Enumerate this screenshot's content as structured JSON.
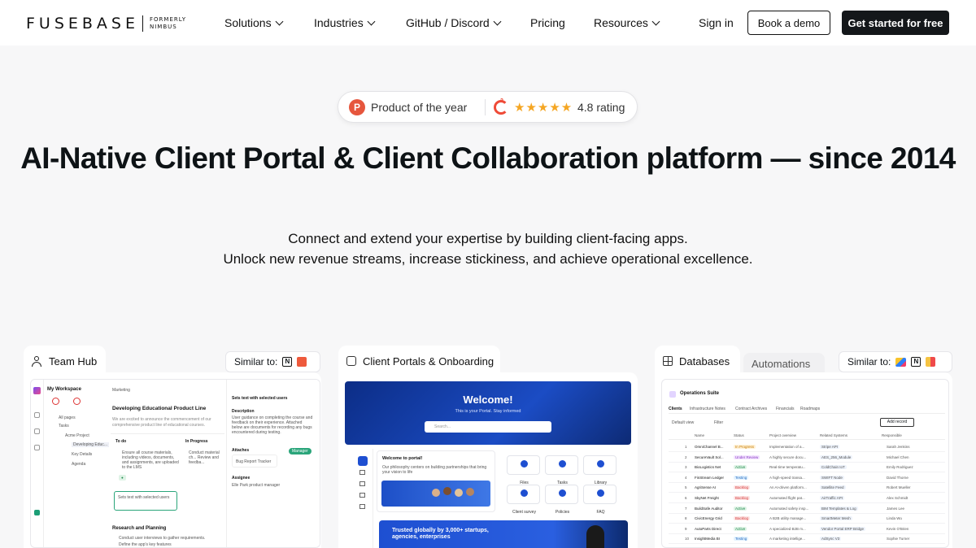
{
  "nav": {
    "logo_main": "FUSEBASE",
    "logo_sub": "FORMERLY NIMBUS",
    "items": [
      {
        "label": "Solutions",
        "has_menu": true
      },
      {
        "label": "Industries",
        "has_menu": true
      },
      {
        "label": "GitHub / Discord",
        "has_menu": true
      },
      {
        "label": "Pricing",
        "has_menu": false
      },
      {
        "label": "Resources",
        "has_menu": true
      }
    ],
    "sign_in": "Sign in",
    "book_demo": "Book a demo",
    "get_started": "Get started for free"
  },
  "badge": {
    "product_of_year": "Product of the year",
    "rating": "4.8 rating",
    "rating_value": 4.8,
    "ph_letter": "P",
    "stars": "★★★★★"
  },
  "hero": {
    "title": "AI-Native Client Portal & Client Collaboration platform — since 2014",
    "sub_line1": "Connect and extend your expertise by building client-facing apps.",
    "sub_line2": "Unlock new revenue streams, increase stickiness, and achieve operational excellence."
  },
  "cards": {
    "team_hub": {
      "tab": "Team Hub",
      "similar": "Similar to:",
      "workspace": "My Workspace",
      "marketing": "Marketing",
      "doc_title": "Developing Educational Product Line",
      "doc_text": "We are excited to announce the commencement of our comprehensive product line of educational courses.",
      "sidebar": [
        "All pages",
        "Tasks",
        "Acme Project",
        "Developing Educ...",
        "Key Details",
        "Agenda"
      ],
      "col_todo": "To do",
      "col_progress": "In Progress",
      "task1": "Ensure all course materials, including videos, documents, and assignments, are uploaded to the LMS",
      "task2": "Conduct material ch... Review and feedba...",
      "task3": "Sets text with selected users",
      "section": "Research and Planning",
      "check1": "Conduct user interviews to gather requirements.",
      "check2": "Define the app's key features",
      "side_title": "Sets text with selected users",
      "side_desc_label": "Description",
      "side_desc": "User guidance on completing the course and feedback on their experience. Attached below are documents for recording any bugs encountered during testing.",
      "attaches": "Attaches",
      "file": "Bug Report Tracker",
      "manager": "Manager",
      "assignee": "Assignee",
      "assignee_val": "Elle Park product manager"
    },
    "portals": {
      "tab": "Client Portals & Onboarding",
      "welcome": "Welcome!",
      "welcome_sub": "This is your Portal. Stay informed",
      "search_placeholder": "Search...",
      "welcome_portal": "Welcome to portal!",
      "philosophy": "Our philosophy centers on building partnerships that bring your vision to life",
      "tiles": [
        "Files",
        "Tasks",
        "Library",
        "Client survey",
        "Policies",
        "FAQ"
      ],
      "trusted": "Trusted globally by 3,000+ startups, agencies, enterprises"
    },
    "databases": {
      "tab": "Databases",
      "tab2": "Automations",
      "similar": "Similar to:",
      "suite": "Operations Suite",
      "tabs": [
        "Clients",
        "Infrastructure Notes",
        "Contract Archives",
        "Financials",
        "Roadmaps"
      ],
      "default_view": "Default view",
      "filter": "Filter",
      "add_record": "Add record",
      "headers": [
        "Name",
        "Status",
        "Project overview",
        "Related Systems",
        "Responsible"
      ],
      "rows": [
        {
          "n": "1",
          "name": "OmniChannel B...",
          "status": "In Progress",
          "overview": "Implementation of a...",
          "systems": "Stripe API",
          "person": "Sarah Jenkins"
        },
        {
          "n": "2",
          "name": "SecureVault Sol...",
          "status": "Under Review",
          "overview": "A highly secure docu...",
          "systems": "AES_256_Module",
          "person": "Michael Chen"
        },
        {
          "n": "3",
          "name": "BioLogistics Net",
          "status": "Active",
          "overview": "Real-time temperatu...",
          "systems": "ColdChain IoT",
          "person": "Emily Rodriguez"
        },
        {
          "n": "4",
          "name": "FinStream Ledger",
          "status": "Testing",
          "overview": "A high-speed transa...",
          "systems": "SWIFT Node",
          "person": "David Thorne"
        },
        {
          "n": "5",
          "name": "AgriSense AI",
          "status": "Backlog",
          "overview": "An AI-driven platform...",
          "systems": "Satellite Feed",
          "person": "Robert Mueller"
        },
        {
          "n": "6",
          "name": "SkyNet Freight",
          "status": "Backlog",
          "overview": "Automated flight pat...",
          "systems": "AirTraffic API",
          "person": "Alex Schmidt"
        },
        {
          "n": "7",
          "name": "BuildSafe Auditor",
          "status": "Active",
          "overview": "Automated safety insp...",
          "systems": "BIM Templates & Log",
          "person": "James Lee"
        },
        {
          "n": "8",
          "name": "CivicEnergy Grid",
          "status": "Backlog",
          "overview": "A B2B utility manage...",
          "systems": "SmartMeter Mesh",
          "person": "Linda Wu"
        },
        {
          "n": "9",
          "name": "AutoParts Direct",
          "status": "Active",
          "overview": "A specialized B2B m...",
          "systems": "Vendor Portal ERP Bridge",
          "person": "Kevin O'Brien"
        },
        {
          "n": "10",
          "name": "InsightMedia BI",
          "status": "Testing",
          "overview": "A marketing intellige...",
          "systems": "AdSync V3",
          "person": "Sophie Turner"
        }
      ]
    }
  },
  "colors": {
    "accent_dark": "#14171a",
    "brand_blue": "#1e4fd1",
    "star": "#f5a623",
    "ph_orange": "#e6563d",
    "status_progress": "#c47a00",
    "status_active": "#1f8a4c",
    "status_backlog": "#d43c3c"
  }
}
